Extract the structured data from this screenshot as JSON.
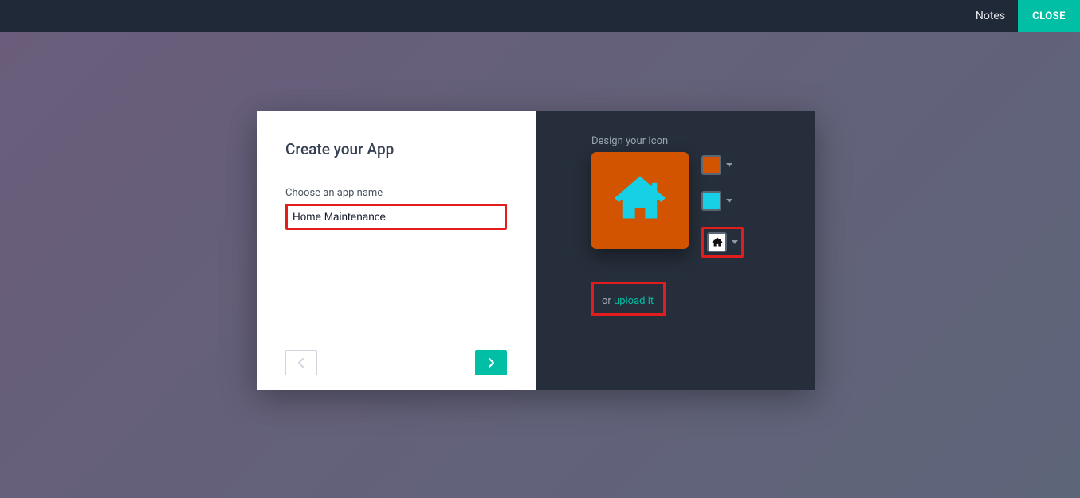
{
  "topbar": {
    "notes_label": "Notes",
    "close_label": "CLOSE"
  },
  "dialog": {
    "title": "Create your App",
    "app_name_label": "Choose an app name",
    "app_name_value": "Home Maintenance",
    "design_label": "Design your Icon",
    "upload_or": "or ",
    "upload_link": "upload it",
    "colors": {
      "background": "#d35400",
      "foreground": "#18d0e6"
    },
    "icon_name": "home-icon"
  }
}
